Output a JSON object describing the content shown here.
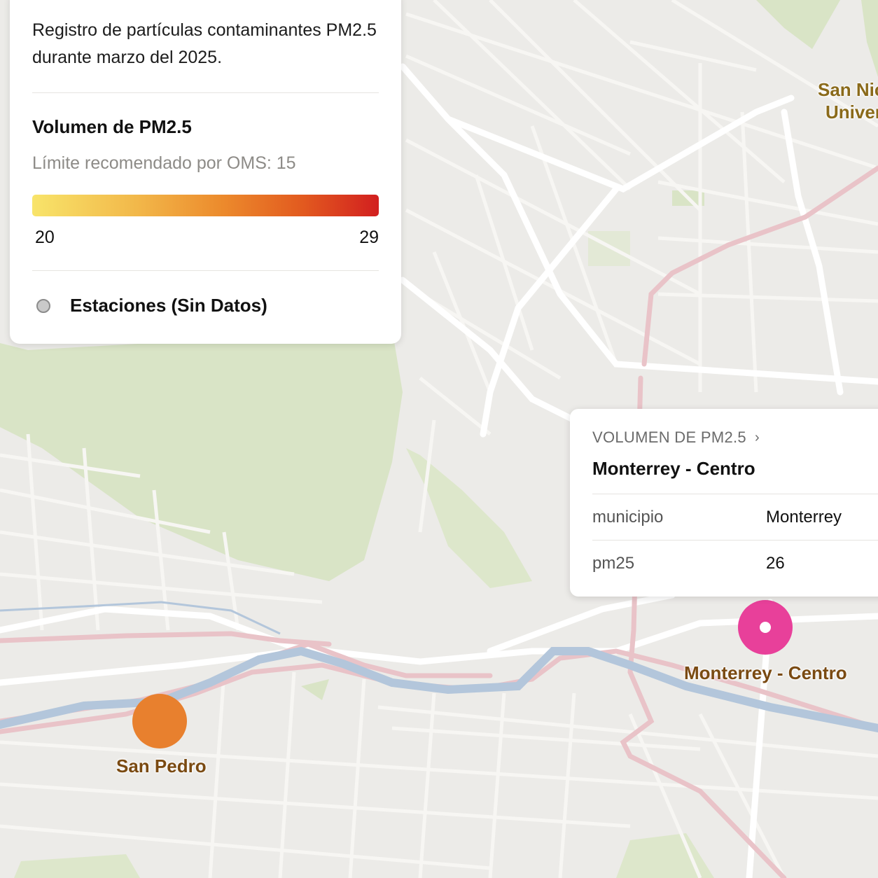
{
  "legend": {
    "description": "Registro de partículas contaminantes PM2.5 durante marzo del 2025.",
    "title": "Volumen de PM2.5",
    "subtitle": "Límite recomendado por OMS: 15",
    "range_min": "20",
    "range_max": "29",
    "gradient_colors": [
      "#f8e46a",
      "#f2b84a",
      "#ec8a2c",
      "#e25a1f",
      "#d21f1f"
    ],
    "station_label": "Estaciones (Sin Datos)",
    "station_color": "#c9c9c9"
  },
  "popup": {
    "header": "VOLUMEN DE PM2.5",
    "chevron_icon": "chevron-right-icon",
    "title": "Monterrey - Centro",
    "rows": [
      {
        "key": "municipio",
        "value": "Monterrey"
      },
      {
        "key": "pm25",
        "value": "26"
      }
    ]
  },
  "stations": [
    {
      "name": "San Pedro",
      "pm25_color": "#e8802e"
    },
    {
      "name": "Monterrey - Centro",
      "pm25_color": "#e8409a"
    }
  ],
  "place_labels": {
    "line1": "San Nic",
    "line2": "Univer"
  },
  "map_colors": {
    "background": "#ecebe8",
    "park": "#d9e4c6",
    "road": "#ffffff",
    "highway": "#e9c3c8",
    "river": "#b3c6db"
  }
}
